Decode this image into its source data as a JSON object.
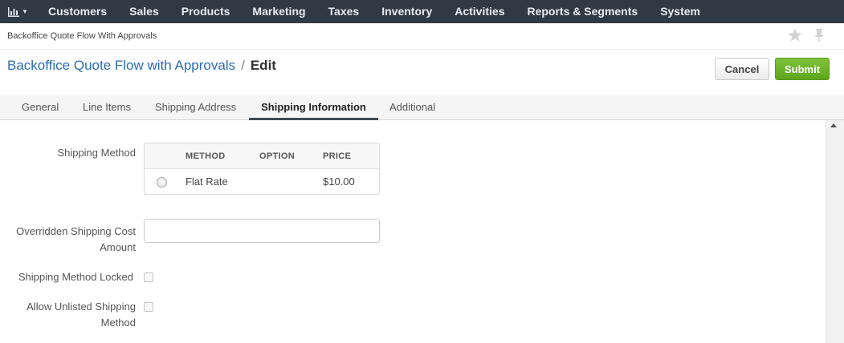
{
  "nav": {
    "logo_icon": "bar-chart-icon",
    "items": [
      "Customers",
      "Sales",
      "Products",
      "Marketing",
      "Taxes",
      "Inventory",
      "Activities",
      "Reports & Segments",
      "System"
    ]
  },
  "breadcrumb": "Backoffice Quote Flow With Approvals",
  "header": {
    "entity_link": "Backoffice Quote Flow with Approvals",
    "separator": "/",
    "mode": "Edit",
    "cancel_label": "Cancel",
    "submit_label": "Submit"
  },
  "tabs": [
    {
      "label": "General",
      "active": false
    },
    {
      "label": "Line Items",
      "active": false
    },
    {
      "label": "Shipping Address",
      "active": false
    },
    {
      "label": "Shipping Information",
      "active": true
    },
    {
      "label": "Additional",
      "active": false
    }
  ],
  "form": {
    "shipping_method_label": "Shipping Method",
    "table_headers": [
      "METHOD",
      "OPTION",
      "PRICE"
    ],
    "methods": [
      {
        "method": "Flat Rate",
        "option": "",
        "price": "$10.00",
        "selected": false
      }
    ],
    "overridden_cost_label_line1": "Overridden Shipping Cost",
    "overridden_cost_label_line2": "Amount",
    "overridden_cost_value": "",
    "method_locked_label": "Shipping Method Locked",
    "method_locked_checked": false,
    "allow_unlisted_label_line1": "Allow Unlisted Shipping",
    "allow_unlisted_label_line2": "Method",
    "allow_unlisted_checked": false
  },
  "colors": {
    "nav_bg": "#2f3a45",
    "link": "#2b6cb0",
    "submit_green": "#6cb42b"
  }
}
